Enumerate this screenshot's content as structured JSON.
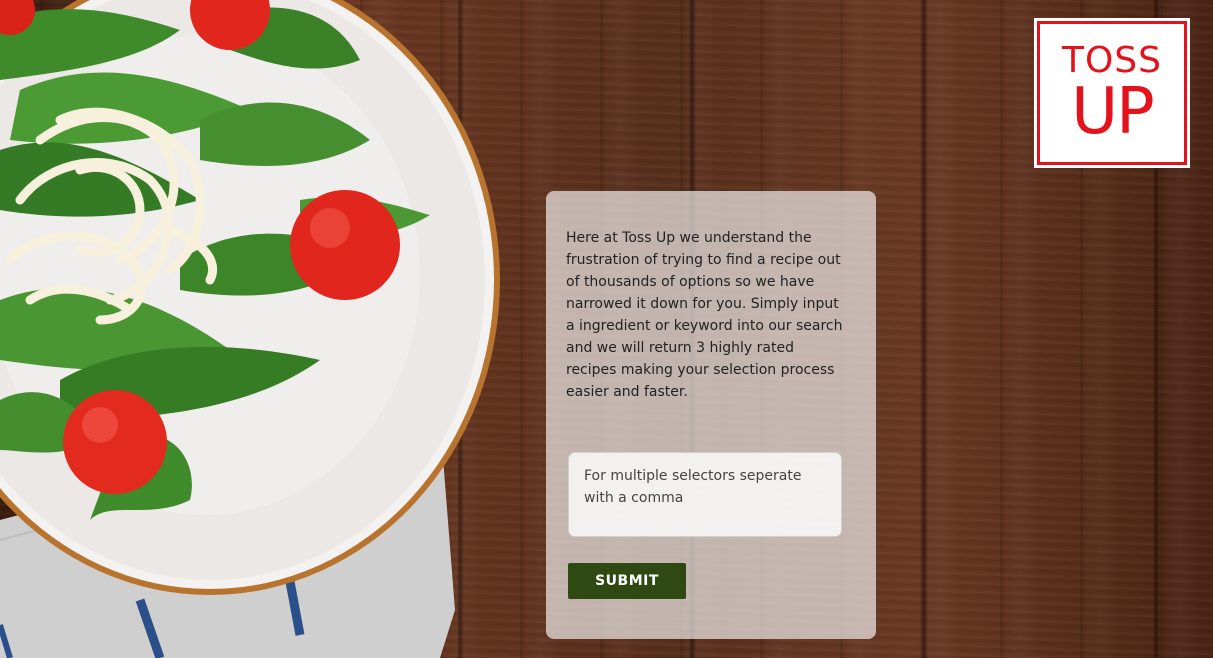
{
  "brand": {
    "logo_line1": "TOSS",
    "logo_line2": "UP",
    "color": "#e3121b"
  },
  "intro": {
    "text": "Here at Toss Up we understand the frustration of trying to find a recipe out of thousands of options so we have narrowed it down for you. Simply input a ingredient or keyword into our search and we will return 3 highly rated recipes making your selection process easier and faster."
  },
  "search": {
    "value": "",
    "placeholder": "For multiple selectors seperate with a comma"
  },
  "actions": {
    "submit_label": "SUBMIT",
    "submit_color": "#2e4a12"
  },
  "background": {
    "image": "salad-plate-on-wood-table"
  }
}
